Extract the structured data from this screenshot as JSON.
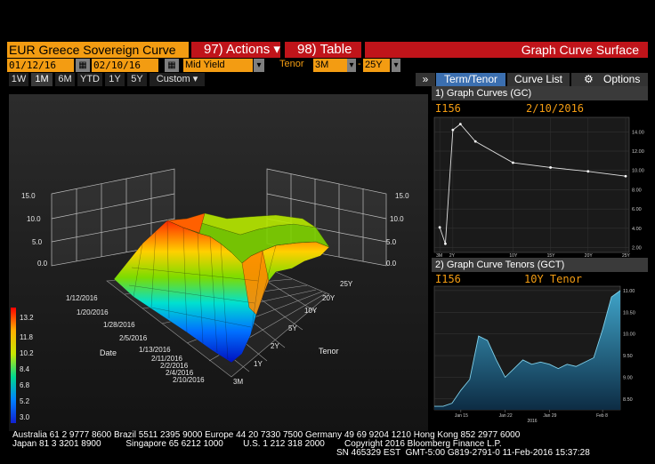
{
  "header": {
    "title": "EUR Greece Sovereign Curve",
    "actions_label": "97) Actions ▾",
    "table_label": "98) Table",
    "function_title": "Graph Curve Surface"
  },
  "controls": {
    "start_date": "01/12/16",
    "end_date": "02/10/16",
    "field": "Mid Yield",
    "tenor_label": "Tenor",
    "tenor_from": "3M",
    "tenor_sep": "-",
    "tenor_to": "25Y"
  },
  "ranges": [
    "1W",
    "1M",
    "6M",
    "YTD",
    "1Y",
    "5Y",
    "Custom ▾"
  ],
  "active_range": "1M",
  "right_tabs": {
    "collapse": "»",
    "term_tenor": "Term/Tenor",
    "curve_list": "Curve List",
    "options": "Options"
  },
  "panel1": {
    "header": "1) Graph Curves (GC)",
    "ticker": "I156",
    "date": "2/10/2016",
    "y_ticks": [
      "14.00",
      "12.00",
      "10.00",
      "8.00",
      "6.00",
      "4.00",
      "2.00"
    ],
    "x_ticks": [
      "3M",
      "2Y",
      "10Y",
      "15Y",
      "20Y",
      "25Y"
    ]
  },
  "panel2": {
    "header": "2) Graph Curve Tenors (GCT)",
    "ticker": "I156",
    "tenor": "10Y Tenor",
    "y_ticks": [
      "11.00",
      "10.50",
      "10.00",
      "9.50",
      "9.00",
      "8.50"
    ],
    "x_ticks": [
      "Jan 15",
      "Jan 22",
      "Jan 29",
      "Feb 8"
    ],
    "x_year": "2016"
  },
  "surface": {
    "date_ticks": [
      "1/12/2016",
      "1/20/2016",
      "1/28/2016",
      "2/5/2016",
      "1/13/2016",
      "2/11/2016",
      "2/2/2016",
      "2/4/2016",
      "2/10/2016"
    ],
    "date_axis_label": "Date",
    "tenor_ticks": [
      "3M",
      "1Y",
      "2Y",
      "5Y",
      "10Y",
      "20Y",
      "25Y"
    ],
    "tenor_axis_label": "Tenor",
    "wall_ticks": [
      "15.0",
      "10.0",
      "5.0",
      "0.0"
    ],
    "legend": [
      "13.2",
      "11.8",
      "10.2",
      "8.4",
      "6.8",
      "5.2",
      "3.0"
    ]
  },
  "footer": {
    "line1": "Australia 61 2 9777 8600 Brazil 5511 2395 9000 Europe 44 20 7330 7500 Germany 49 69 9204 1210 Hong Kong 852 2977 6000",
    "line2": "Japan 81 3 3201 8900          Singapore 65 6212 1000        U.S. 1 212 318 2000        Copyright 2016 Bloomberg Finance L.P.",
    "line3": "SN 465329 EST  GMT-5:00 G819-2791-0 11-Feb-2016 15:37:28"
  },
  "chart_data": [
    {
      "type": "line",
      "title": "Graph Curves (GC)",
      "x": [
        "3M",
        "1Y",
        "2Y",
        "3Y",
        "5Y",
        "10Y",
        "15Y",
        "20Y",
        "25Y"
      ],
      "series": [
        {
          "name": "I156",
          "values": [
            4.1,
            2.4,
            14.2,
            14.8,
            13.0,
            10.8,
            10.3,
            9.9,
            9.4
          ]
        }
      ],
      "ylim": [
        1.5,
        15.5
      ]
    },
    {
      "type": "area",
      "title": "10Y Tenor",
      "x": [
        "1/12",
        "1/13",
        "1/14",
        "1/15",
        "1/18",
        "1/19",
        "1/20",
        "1/21",
        "1/22",
        "1/25",
        "1/26",
        "1/27",
        "1/28",
        "1/29",
        "2/1",
        "2/2",
        "2/3",
        "2/4",
        "2/5",
        "2/8",
        "2/9",
        "2/10"
      ],
      "series": [
        {
          "name": "I156",
          "values": [
            8.33,
            8.33,
            8.4,
            8.7,
            8.95,
            9.95,
            9.85,
            9.4,
            9.0,
            9.2,
            9.4,
            9.3,
            9.35,
            9.3,
            9.2,
            9.3,
            9.25,
            9.35,
            9.45,
            10.1,
            10.85,
            11.0
          ]
        }
      ],
      "ylim": [
        8.25,
        11.1
      ]
    }
  ]
}
